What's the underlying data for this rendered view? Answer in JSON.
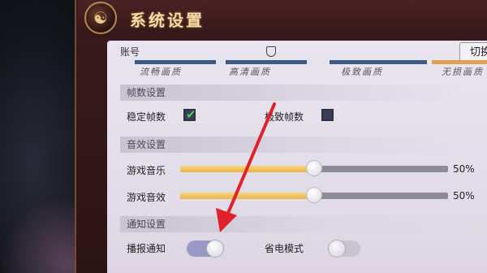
{
  "window": {
    "title": "系统设置",
    "emblem_glyph": "☯"
  },
  "account": {
    "label": "账号",
    "switch_button": "切换"
  },
  "quality_options": [
    {
      "label": "流畅画质",
      "active": false
    },
    {
      "label": "高清画质",
      "active": false
    },
    {
      "label": "极致画质",
      "active": false
    },
    {
      "label": "无损画质",
      "active": true
    }
  ],
  "sections": {
    "frame": {
      "title": "帧数设置",
      "stable_label": "稳定帧数",
      "stable_checked": true,
      "extreme_label": "极致帧数",
      "extreme_checked": false
    },
    "sound": {
      "title": "音效设置",
      "music_label": "游戏音乐",
      "music_value": "50%",
      "music_level": 0.5,
      "effects_label": "游戏音效",
      "effects_value": "50%",
      "effects_level": 0.5
    },
    "notify": {
      "title": "通知设置",
      "broadcast_label": "播报通知",
      "broadcast_on": true,
      "powersave_label": "省电模式",
      "powersave_on": false
    }
  },
  "colors": {
    "accent_gold": "#e9b44a",
    "arrow_red": "#e0202a",
    "check_green": "#3fd45a"
  }
}
